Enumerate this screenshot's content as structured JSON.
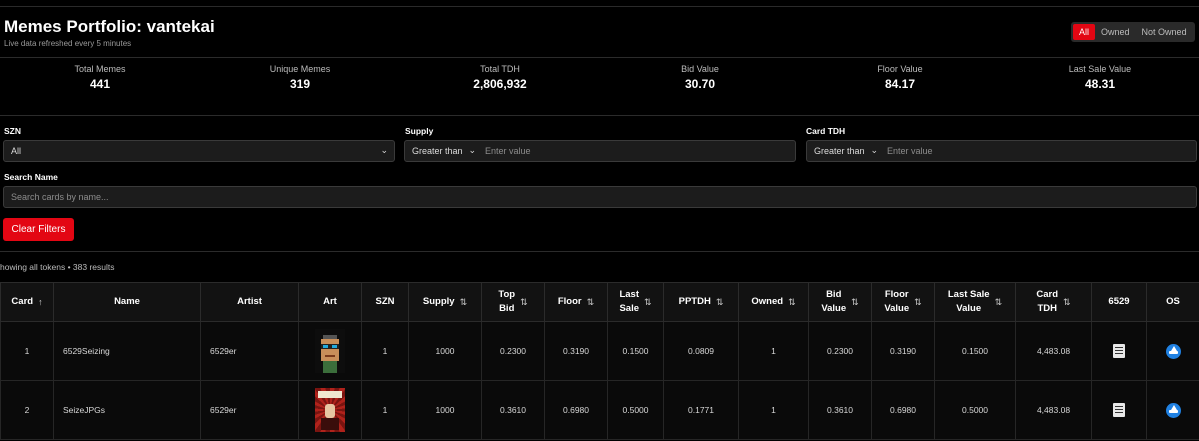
{
  "header": {
    "title": "Memes Portfolio: vantekai",
    "subtitle": "Live data refreshed every 5 minutes"
  },
  "filter_toggle": {
    "options": [
      "All",
      "Owned",
      "Not Owned"
    ],
    "active": "All"
  },
  "stats": [
    {
      "label": "Total Memes",
      "value": "441"
    },
    {
      "label": "Unique Memes",
      "value": "319"
    },
    {
      "label": "Total TDH",
      "value": "2,806,932"
    },
    {
      "label": "Bid Value",
      "value": "30.70"
    },
    {
      "label": "Floor Value",
      "value": "84.17"
    },
    {
      "label": "Last Sale Value",
      "value": "48.31"
    }
  ],
  "filters": {
    "szn": {
      "label": "SZN",
      "value": "All"
    },
    "supply": {
      "label": "Supply",
      "operator": "Greater than",
      "placeholder": "Enter value"
    },
    "card_tdh": {
      "label": "Card TDH",
      "operator": "Greater than",
      "placeholder": "Enter value"
    },
    "search": {
      "label": "Search Name",
      "placeholder": "Search cards by name..."
    },
    "clear_label": "Clear Filters"
  },
  "results_text": "howing all tokens • 383 results",
  "table": {
    "columns": [
      {
        "l1": "Card",
        "l2": "",
        "sort": "↑"
      },
      {
        "l1": "Name",
        "l2": "",
        "sort": ""
      },
      {
        "l1": "Artist",
        "l2": "",
        "sort": ""
      },
      {
        "l1": "Art",
        "l2": "",
        "sort": ""
      },
      {
        "l1": "SZN",
        "l2": "",
        "sort": ""
      },
      {
        "l1": "Supply",
        "l2": "",
        "sort": "⇅"
      },
      {
        "l1": "Top",
        "l2": "Bid",
        "sort": "⇅"
      },
      {
        "l1": "Floor",
        "l2": "",
        "sort": "⇅"
      },
      {
        "l1": "Last",
        "l2": "Sale",
        "sort": "⇅"
      },
      {
        "l1": "PPTDH",
        "l2": "",
        "sort": "⇅"
      },
      {
        "l1": "Owned",
        "l2": "",
        "sort": "⇅"
      },
      {
        "l1": "Bid",
        "l2": "Value",
        "sort": "⇅"
      },
      {
        "l1": "Floor",
        "l2": "Value",
        "sort": "⇅"
      },
      {
        "l1": "Last Sale",
        "l2": "Value",
        "sort": "⇅"
      },
      {
        "l1": "Card",
        "l2": "TDH",
        "sort": "⇅"
      },
      {
        "l1": "6529",
        "l2": "",
        "sort": ""
      },
      {
        "l1": "OS",
        "l2": "",
        "sort": ""
      }
    ],
    "rows": [
      {
        "card": "1",
        "name": "6529Seizing",
        "artist": "6529er",
        "szn": "1",
        "supply": "1000",
        "top_bid": "0.2300",
        "floor": "0.3190",
        "last_sale": "0.1500",
        "pptdh": "0.0809",
        "owned": "1",
        "bid_value": "0.2300",
        "floor_value": "0.3190",
        "last_sale_value": "0.1500",
        "card_tdh": "4,483.08"
      },
      {
        "card": "2",
        "name": "SeizeJPGs",
        "artist": "6529er",
        "szn": "1",
        "supply": "1000",
        "top_bid": "0.3610",
        "floor": "0.6980",
        "last_sale": "0.5000",
        "pptdh": "0.1771",
        "owned": "1",
        "bid_value": "0.3610",
        "floor_value": "0.6980",
        "last_sale_value": "0.5000",
        "card_tdh": "4,483.08"
      }
    ]
  },
  "icons": {
    "sort_asc": "arrow-up-icon",
    "sort_both": "sort-arrows-icon",
    "select_chevron": "chevron-down-icon",
    "link_6529": "document-icon",
    "link_os": "opensea-icon"
  },
  "colors": {
    "accent": "#e30613",
    "background": "#000000",
    "opensea": "#2081e2"
  }
}
